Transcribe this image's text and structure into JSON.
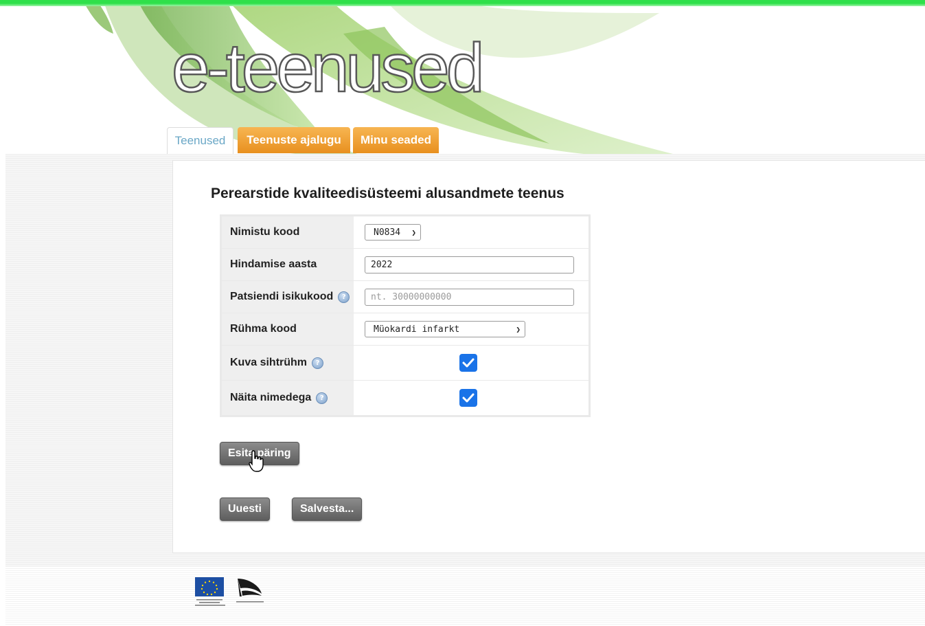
{
  "header": {
    "brand": "e-teenused"
  },
  "tabs": [
    {
      "label": "Teenused",
      "active": true
    },
    {
      "label": "Teenuste ajalugu",
      "active": false
    },
    {
      "label": "Minu seaded",
      "active": false
    }
  ],
  "page": {
    "title": "Perearstide kvaliteedisüsteemi alusandmete teenus"
  },
  "form": {
    "nimistu_label": "Nimistu kood",
    "nimistu_value": "N0834",
    "aasta_label": "Hindamise aasta",
    "aasta_value": "2022",
    "isikukood_label": "Patsiendi isikukood",
    "isikukood_placeholder": "nt. 30000000000",
    "ryhm_label": "Rühma kood",
    "ryhm_value": "Müokardi infarkt",
    "sihtryhm_label": "Kuva sihtrühm",
    "sihtryhm_checked": true,
    "nimedega_label": "Näita nimedega",
    "nimedega_checked": true
  },
  "buttons": {
    "submit": "Esita päring",
    "reset": "Uuesti",
    "save": "Salvesta..."
  },
  "colors": {
    "tab_orange": "#f3a43a",
    "tab_active_text": "#6aa7c6",
    "checkbox_blue": "#1a73e8",
    "top_bar": "#2fe04a"
  }
}
